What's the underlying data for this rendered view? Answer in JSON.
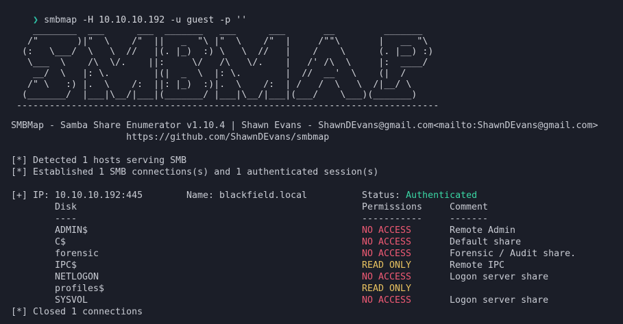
{
  "prompt": {
    "symbol": "❯",
    "command": "smbmap",
    "args": "-H 10.10.10.192 -u guest -p ''"
  },
  "banner": {
    "art": "    ________  ___      ___  _______   ___      ___       __         _______\n   /\"       )|\"  \\    /\"  ||   _  \"\\ |\"  \\    /\"  |     /\"\"\\       |   __ \"\\\n  (:   \\___/  \\   \\  //   |(. |_)  :) \\   \\  //   |    /    \\      (. |__) :)\n   \\___  \\    /\\  \\/.    ||:     \\/   /\\   \\/.    |   /' /\\  \\     |:  ____/\n    __/  \\   |: \\.        |(|  _  \\  |: \\.        |  //  __'  \\    (|  /\n   /\" \\   :) |.  \\    /:  ||: |_)  :)|.  \\    /:  | /   /  \\   \\  /|__/ \\\n  (_______/  |___|\\__/|___|(_______/ |___|\\__/|___|(___/    \\___)(_______)\n -----------------------------------------------------------------------------"
  },
  "about": {
    "line1": "SMBMap - Samba Share Enumerator v1.10.4 | Shawn Evans - ShawnDEvans@gmail.com<mailto:ShawnDEvans@gmail.com>",
    "line2": "                     https://github.com/ShawnDEvans/smbmap"
  },
  "log": {
    "detected": "[*] Detected 1 hosts serving SMB",
    "established": "[*] Established 1 SMB connections(s) and 1 authenticated session(s)",
    "closed": "[*] Closed 1 connections"
  },
  "host": {
    "ip_label": "[+] IP: 10.10.10.192:445",
    "name_label": "Name: blackfield.local",
    "status_label": "Status:",
    "status_value": "Authenticated"
  },
  "table": {
    "headers": {
      "disk": "Disk",
      "permissions": "Permissions",
      "comment": "Comment"
    },
    "separators": {
      "disk": "----",
      "permissions": "-----------",
      "comment": "-------"
    },
    "rows": [
      {
        "disk": "ADMIN$",
        "permissions": "NO ACCESS",
        "comment": "Remote Admin"
      },
      {
        "disk": "C$",
        "permissions": "NO ACCESS",
        "comment": "Default share"
      },
      {
        "disk": "forensic",
        "permissions": "NO ACCESS",
        "comment": "Forensic / Audit share."
      },
      {
        "disk": "IPC$",
        "permissions": "READ ONLY",
        "comment": "Remote IPC"
      },
      {
        "disk": "NETLOGON",
        "permissions": "NO ACCESS",
        "comment": "Logon server share"
      },
      {
        "disk": "profiles$",
        "permissions": "READ ONLY",
        "comment": ""
      },
      {
        "disk": "SYSVOL",
        "permissions": "NO ACCESS",
        "comment": "Logon server share"
      }
    ]
  },
  "colors": {
    "background": "#1b1e28",
    "prompt": "#2ec4a8",
    "authenticated": "#3ad6a4",
    "no_access": "#f05a74",
    "read_only": "#e8c260"
  }
}
